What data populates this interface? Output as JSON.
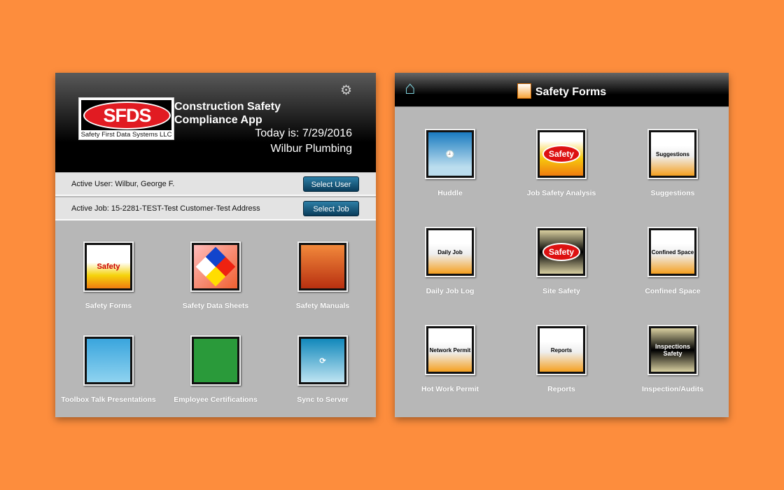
{
  "left": {
    "logo": {
      "text": "SFDS",
      "subtitle": "Safety First Data Systems LLC"
    },
    "app_title": "Construction Safety Compliance App",
    "today": "Today is: 7/29/2016",
    "company": "Wilbur Plumbing",
    "settings_icon": "gear-icon",
    "active_user": "Active User: Wilbur, George F.",
    "select_user": "Select User",
    "active_job": "Active Job: 15-2281-TEST-Test Customer-Test Address",
    "select_job": "Select Job",
    "tiles": [
      {
        "label": "Safety Forms",
        "icon_text": "Safety"
      },
      {
        "label": "Safety Data Sheets",
        "icon_text": ""
      },
      {
        "label": "Safety Manuals",
        "icon_text": ""
      },
      {
        "label": "Toolbox Talk Presentations",
        "icon_text": ""
      },
      {
        "label": "Employee Certifications",
        "icon_text": ""
      },
      {
        "label": "Sync to Server",
        "icon_text": ""
      }
    ]
  },
  "right": {
    "home_icon": "home-icon",
    "title": "Safety Forms",
    "tiles": [
      {
        "label": "Huddle",
        "icon_text": ""
      },
      {
        "label": "Job Safety Analysis",
        "icon_text": "Safety"
      },
      {
        "label": "Suggestions",
        "icon_text": "Suggestions"
      },
      {
        "label": "Daily Job Log",
        "icon_text": "Daily Job"
      },
      {
        "label": "Site Safety",
        "icon_text": "Safety"
      },
      {
        "label": "Confined Space",
        "icon_text": "Confined Space"
      },
      {
        "label": "Hot Work Permit",
        "icon_text": "Network Permit"
      },
      {
        "label": "Reports",
        "icon_text": "Reports"
      },
      {
        "label": "Inspection/Audits",
        "icon_text": "Inspections Safety"
      }
    ]
  },
  "colors": {
    "background": "#fd8d3d",
    "panel": "#b7b7b7",
    "button": "#1a5a80",
    "home": "#7fd2dc"
  }
}
